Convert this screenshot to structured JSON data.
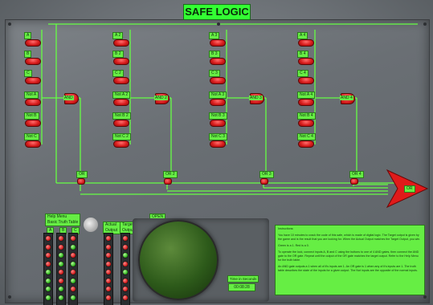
{
  "title": "SAFE LOGIC",
  "columns": [
    {
      "labels": [
        "A",
        "B",
        "C",
        "Not A",
        "Not B",
        "Not C"
      ],
      "and_label": "AND",
      "or_label": "OR"
    },
    {
      "labels": [
        "A 2",
        "B 2",
        "C 2",
        "Not A 2",
        "Not B 2",
        "Not C 2"
      ],
      "and_label": "AND 2",
      "or_label": "OR 2"
    },
    {
      "labels": [
        "A 3",
        "B 3",
        "C 3",
        "Not A 3",
        "Not B 3",
        "Not C 3"
      ],
      "and_label": "AND 3",
      "or_label": "OR 3"
    },
    {
      "labels": [
        "A 4",
        "B 4",
        "C 4",
        "Not A 4",
        "Not B 4",
        "Not C 4"
      ],
      "and_label": "AND 4",
      "or_label": "OR 4"
    }
  ],
  "final_gate_label": "OR",
  "open_label": "OPEN",
  "help": {
    "line1": "Help Menu",
    "line2": "Basic Truth Table"
  },
  "help_columns": [
    "A",
    "B",
    "C"
  ],
  "output_labels": {
    "actual": "Actual Output",
    "target": "Target Output"
  },
  "instructions": {
    "heading": "Instructions:",
    "p1": "You have 10 minutes to crack the code of this safe, which is made of digital logic. The Target output is given by the game and is the result that you are looking for. When the Actual Output matches the Target Output, you win.",
    "p2": "Green is a 1. Red is a 0.",
    "p3": "To operate the lock, connect inputs A, B and C using the buttons to one of 4 AND gates, then connect the AND gate to the OR gate. Repeat until the output of the OR gate matches the target output. Refer to the Help Menu for the truth table.",
    "p4": "An AND gate outputs a 1 when all of it's inputs are 1. An OR gate is 1 when any of it's inputs are 1. The truth table describes the state of the inputs for a given output. The Not inputs are the opposite of the normal inputs."
  },
  "timer": {
    "label": "Time in Seconds",
    "value": "00:08:28"
  },
  "led_columns": {
    "A": [
      "r",
      "r",
      "r",
      "r",
      "g",
      "g",
      "g",
      "g"
    ],
    "B": [
      "r",
      "r",
      "g",
      "g",
      "r",
      "r",
      "g",
      "g"
    ],
    "C": [
      "r",
      "g",
      "r",
      "g",
      "r",
      "g",
      "r",
      "g"
    ],
    "actual": [
      "r",
      "r",
      "r",
      "r",
      "r",
      "r",
      "r",
      "r"
    ],
    "target": [
      "r",
      "r",
      "g",
      "r",
      "g",
      "r",
      "r",
      "r"
    ]
  },
  "colors": {
    "wire": "#66ff44",
    "button": "#d81c1c",
    "label_bg": "#66ee44"
  }
}
